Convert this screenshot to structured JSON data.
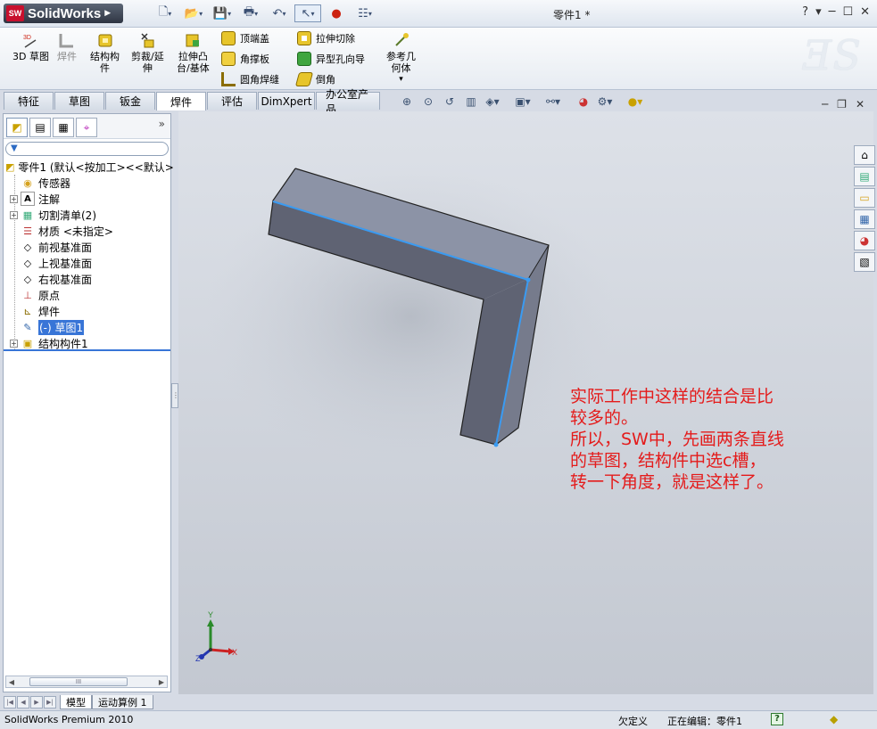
{
  "app": {
    "name": "SolidWorks",
    "logo_badge": "SW",
    "document_title": "零件1 *"
  },
  "titlebar": {
    "help": "?",
    "help_dropdown": "▾",
    "minimize": "─",
    "restore": "☐",
    "close": "✕"
  },
  "ribbon": {
    "sketch3d": "3D 草图",
    "weldment": "焊件",
    "structural_member": "结构构\n件",
    "trim_extend": "剪裁/延\n伸",
    "extruded_boss": "拉伸凸\n台/基体",
    "end_cap": "顶端盖",
    "gusset": "角撑板",
    "fillet_bead": "圆角焊缝",
    "extruded_cut": "拉伸切除",
    "hole_wizard": "异型孔向导",
    "chamfer": "倒角",
    "ref_geometry": "参考几\n何体",
    "ref_geometry_dropdown": "▾"
  },
  "tabs": [
    {
      "label": "特征"
    },
    {
      "label": "草图"
    },
    {
      "label": "钣金"
    },
    {
      "label": "焊件"
    },
    {
      "label": "评估"
    },
    {
      "label": "DimXpert"
    },
    {
      "label": "办公室产品"
    }
  ],
  "tree": {
    "root": "零件1 (默认<按加工><<默认>",
    "items": [
      {
        "label": "传感器"
      },
      {
        "label": "注解"
      },
      {
        "label": "切割清单(2)"
      },
      {
        "label": "材质 <未指定>"
      },
      {
        "label": "前视基准面"
      },
      {
        "label": "上视基准面"
      },
      {
        "label": "右视基准面"
      },
      {
        "label": "原点"
      },
      {
        "label": "焊件"
      },
      {
        "label": "(-) 草图1"
      },
      {
        "label": "结构构件1"
      }
    ],
    "more": "»",
    "scroll_grip": "III"
  },
  "bottom_tabs": [
    {
      "label": "模型"
    },
    {
      "label": "运动算例 1"
    }
  ],
  "status": {
    "product": "SolidWorks Premium 2010",
    "definition": "欠定义",
    "editing": "正在编辑：零件1",
    "help": "?"
  },
  "annotation": {
    "text": "实际工作中这样的结合是比\n较多的。\n所以，SW中，先画两条直线\n的草图，结构件中选c槽，\n转一下角度，就是这样了。",
    "color": "#e41b1b"
  },
  "triad": {
    "x": "X",
    "y": "Y",
    "z": "Z"
  },
  "colors": {
    "part_top": "#8c93a6",
    "part_side_dark": "#5f6373",
    "part_side_mid": "#767b8c",
    "sketch_line": "#3a9bf2",
    "selection": "#3875d7"
  }
}
